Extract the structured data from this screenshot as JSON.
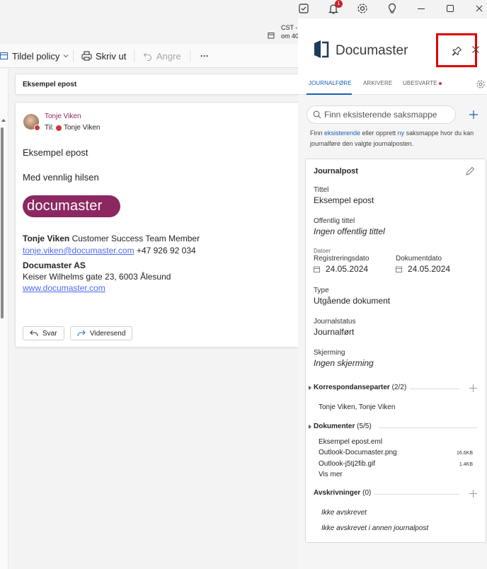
{
  "titlebar": {
    "notification_count": "1",
    "icons": [
      "clipboard-icon",
      "bell-icon",
      "gear-icon",
      "lightbulb-icon",
      "minimize-icon",
      "maximize-icon",
      "close-icon"
    ]
  },
  "reminder": {
    "line1": "CST -",
    "line2": "om 40"
  },
  "toolbar": {
    "policy_label": "Tildel policy",
    "print_label": "Skriv ut",
    "undo_label": "Angre",
    "more_label": "···"
  },
  "email": {
    "subject": "Eksempel epost",
    "sender_name": "Tonje Viken",
    "to_prefix": "Til:",
    "to_name": "Tonje Viken",
    "body_line1": "Eksempel epost",
    "body_line2": "Med vennlig hilsen",
    "logo_text": "documaster",
    "sig_name": "Tonje Viken",
    "sig_title": "Customer Success Team Member",
    "sig_email": "tonje.viken@documaster.com",
    "sig_phone": "+47 926 92 034",
    "sig_company": "Documaster AS",
    "sig_address": "Keiser Wilhelms gate 23, 6003 Ålesund",
    "sig_web": "www.documaster.com",
    "reply_label": "Svar",
    "forward_label": "Videresend"
  },
  "panel": {
    "app_name": "Documaster",
    "tabs": [
      {
        "label": "JOURNALFØRE",
        "active": true
      },
      {
        "label": "ARKIVERE",
        "active": false
      },
      {
        "label": "UBESVARTE",
        "active": false
      }
    ],
    "search_placeholder": "Finn eksisterende saksmappe",
    "help_before": "Finn ",
    "help_link1": "eksisterende",
    "help_middle": " eller opprett ",
    "help_link2": "ny",
    "help_after": " saksmappe hvor du kan journalføre den valgte journalposten.",
    "journalpost": {
      "heading": "Journalpost",
      "title_label": "Tittel",
      "title_value": "Eksempel epost",
      "public_title_label": "Offentlig tittel",
      "public_title_value": "Ingen offentlig tittel",
      "dates_label": "Datoer",
      "reg_date_label": "Registreringsdato",
      "reg_date_value": "24.05.2024",
      "doc_date_label": "Dokumentdato",
      "doc_date_value": "24.05.2024",
      "type_label": "Type",
      "type_value": "Utgående dokument",
      "status_label": "Journalstatus",
      "status_value": "Journalført",
      "shield_label": "Skjerming",
      "shield_value": "Ingen skjerming"
    },
    "correspondents": {
      "label": "Korrespondanseparter",
      "count": "(2/2)",
      "value": "Tonje Viken, Tonje Viken"
    },
    "documents": {
      "label": "Dokumenter",
      "count": "(5/5)",
      "items": [
        {
          "name": "Eksempel epost.eml",
          "size": ""
        },
        {
          "name": "Outlook-Documaster.png",
          "size": "16.6KB"
        },
        {
          "name": "Outlook-j5tj2fib.gif",
          "size": "1.4KB"
        }
      ],
      "more_label": "Vis mer"
    },
    "write_offs": {
      "label": "Avskrivninger",
      "count": "(0)",
      "items": [
        "Ikke avskrevet",
        "Ikke avskrevet i annen journalpost"
      ]
    }
  }
}
